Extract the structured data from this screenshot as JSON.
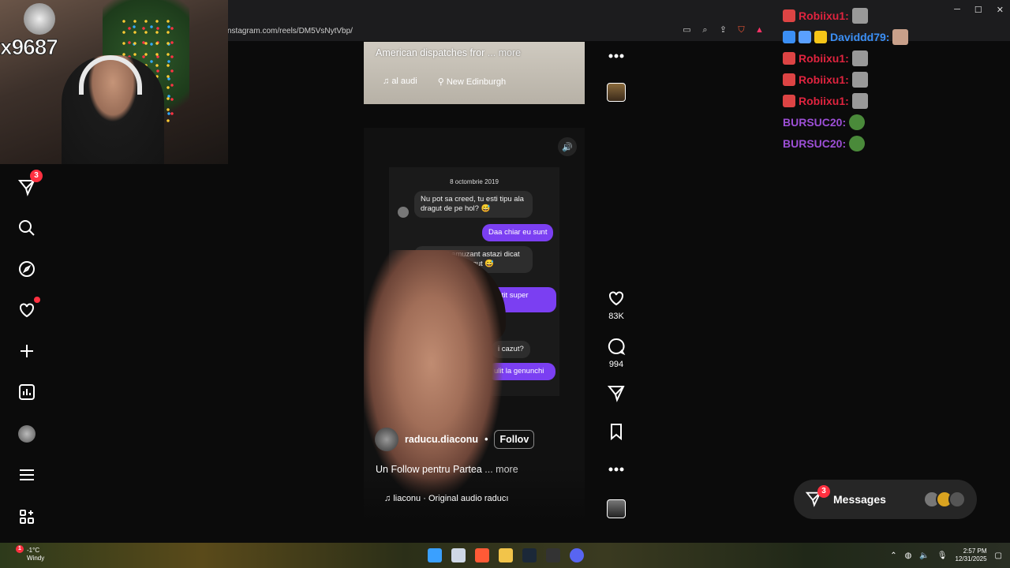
{
  "browser": {
    "url": "nstagram.com/reels/DM5VsNytVbp/"
  },
  "webcam": {
    "overlay_text": "x9687"
  },
  "nav": {
    "messages_badge": "3"
  },
  "reel_prev": {
    "caption": "American dispatches fror",
    "more": "... more",
    "audio": "al audi",
    "location": "New Edinburgh"
  },
  "reel": {
    "chat": {
      "date": "8 octombrie 2019",
      "msg1": "Nu pot sa creed, tu esti tipu ala dragut de pe hol? 😅",
      "msg2": "Daa chiar eu sunt",
      "msg3": "Mi s arut amuzant astazi dicat pe hol, sa e dragut 😅",
      "msg4": "simtit super",
      "msg5": "i cazut?",
      "msg6": "ulit la genunchi"
    },
    "username": "raducu.diaconu",
    "separator": "•",
    "follow": "Follov",
    "caption": "Un Follow pentru Partea",
    "more": "... more",
    "audio": "liaconu · Original audio  raducı"
  },
  "actions": {
    "likes": "83K",
    "comments": "994"
  },
  "stream_chat": [
    {
      "user": "Robiixu1:",
      "color": "#e0243f"
    },
    {
      "user": "Daviddd79:",
      "color": "#3b8ff5"
    },
    {
      "user": "Robiixu1:",
      "color": "#e0243f"
    },
    {
      "user": "Robiixu1:",
      "color": "#e0243f"
    },
    {
      "user": "Robiixu1:",
      "color": "#e0243f"
    },
    {
      "user": "BURSUC20:",
      "color": "#9d4fd6"
    },
    {
      "user": "BURSUC20:",
      "color": "#9d4fd6"
    }
  ],
  "messages": {
    "label": "Messages",
    "badge": "3"
  },
  "taskbar": {
    "badge": "1",
    "temp": "-1°C",
    "weather": "Windy",
    "time": "2:57 PM",
    "date": "12/31/2025"
  }
}
